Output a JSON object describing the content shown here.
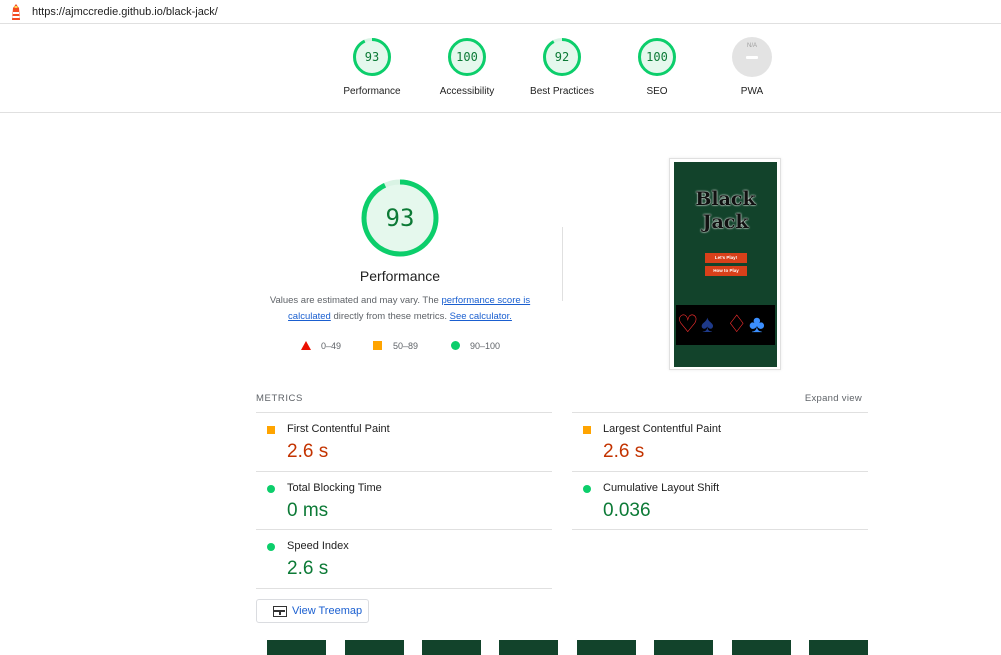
{
  "url": "https://ajmccredie.github.io/black-jack/",
  "categories": [
    {
      "score": "93",
      "label": "Performance"
    },
    {
      "score": "100",
      "label": "Accessibility"
    },
    {
      "score": "92",
      "label": "Best Practices"
    },
    {
      "score": "100",
      "label": "SEO"
    },
    {
      "score": "N/A",
      "label": "PWA"
    }
  ],
  "performance": {
    "score": "93",
    "title": "Performance",
    "note_pre": "Values are estimated and may vary. The",
    "note_link1": "performance score is calculated",
    "note_mid": "directly from these metrics.",
    "note_link2": "See calculator."
  },
  "legend": {
    "fail": "0–49",
    "average": "50–89",
    "pass": "90–100"
  },
  "colors": {
    "pass": "#0cce6b",
    "average": "#ffa400",
    "fail": "#eb0f00",
    "pass_text": "#0c7a36",
    "average_text": "#c33300"
  },
  "screenshot": {
    "title_line1": "Black",
    "title_line2": "Jack",
    "btn1": "Let's Play!",
    "btn2": "How to Play",
    "suits": [
      "♡",
      "♠",
      "♢",
      "♣"
    ]
  },
  "metrics": {
    "header": "METRICS",
    "expand": "Expand view",
    "items": [
      {
        "title": "First Contentful Paint",
        "value": "2.6 s",
        "rating": "average"
      },
      {
        "title": "Largest Contentful Paint",
        "value": "2.6 s",
        "rating": "average"
      },
      {
        "title": "Total Blocking Time",
        "value": "0 ms",
        "rating": "pass"
      },
      {
        "title": "Cumulative Layout Shift",
        "value": "0.036",
        "rating": "pass"
      },
      {
        "title": "Speed Index",
        "value": "2.6 s",
        "rating": "pass"
      }
    ]
  },
  "treemap_label": "View Treemap"
}
